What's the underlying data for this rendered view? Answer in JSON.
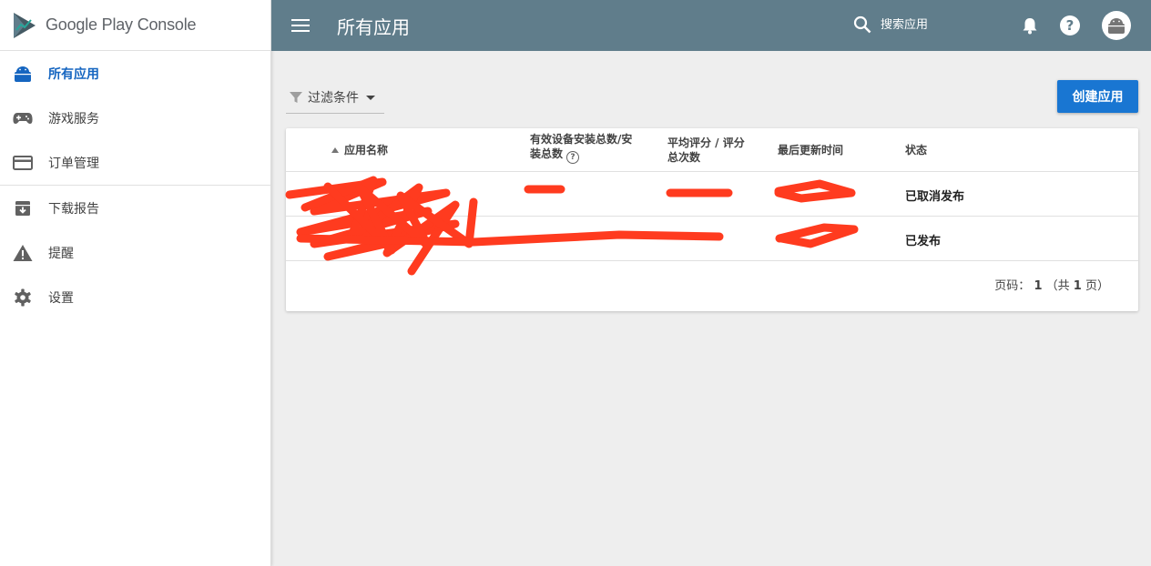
{
  "brand": {
    "name_part1": "Google Play",
    "name_part2": "Console",
    "logo_icon": "play-console-logo"
  },
  "sidebar": {
    "items": [
      {
        "label": "所有应用",
        "icon": "android-icon",
        "active": true
      },
      {
        "label": "游戏服务",
        "icon": "gamepad-icon",
        "active": false
      },
      {
        "label": "订单管理",
        "icon": "credit-card-icon",
        "active": false
      },
      {
        "label": "下载报告",
        "icon": "download-box-icon",
        "active": false
      },
      {
        "label": "提醒",
        "icon": "warning-icon",
        "active": false
      },
      {
        "label": "设置",
        "icon": "gear-icon",
        "active": false
      }
    ]
  },
  "topbar": {
    "title": "所有应用",
    "search_placeholder": "搜索应用",
    "color": "#607d8b"
  },
  "filter": {
    "label": "过滤条件"
  },
  "create_button": {
    "label": "创建应用",
    "color": "#1976d2"
  },
  "table": {
    "headers": {
      "name": "应用名称",
      "installs": "有效设备安装总数/安装总数",
      "rating": "平均评分 / 评分总次数",
      "updated": "最后更新时间",
      "status": "状态"
    },
    "rows": [
      {
        "status": "已取消发布"
      },
      {
        "status": "已发布"
      }
    ],
    "pager": {
      "prefix": "页码：",
      "current": "1",
      "total_prefix": "（共",
      "total": "1",
      "total_suffix": "页）"
    }
  },
  "accent_color": "#1565c0"
}
